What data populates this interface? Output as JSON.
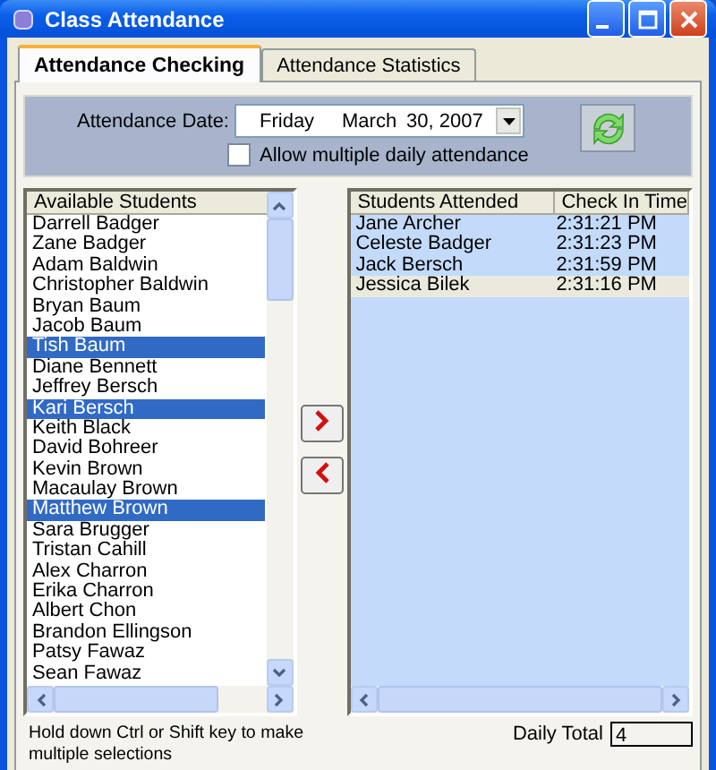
{
  "window": {
    "title": "Class Attendance"
  },
  "tabs": [
    {
      "label": "Attendance Checking",
      "selected": true
    },
    {
      "label": "Attendance Statistics",
      "selected": false
    }
  ],
  "date_field": {
    "label": "Attendance Date:",
    "weekday": "Friday",
    "month": "March",
    "day_year": "30, 2007"
  },
  "multiple_attendance": {
    "label": "Allow multiple daily attendance",
    "checked": false
  },
  "available_students": {
    "header": "Available Students",
    "items": [
      {
        "name": "Darrell Badger",
        "selected": false
      },
      {
        "name": "Zane Badger",
        "selected": false
      },
      {
        "name": "Adam Baldwin",
        "selected": false
      },
      {
        "name": "Christopher Baldwin",
        "selected": false
      },
      {
        "name": "Bryan Baum",
        "selected": false
      },
      {
        "name": "Jacob Baum",
        "selected": false
      },
      {
        "name": "Tish Baum",
        "selected": true
      },
      {
        "name": "Diane Bennett",
        "selected": false
      },
      {
        "name": "Jeffrey Bersch",
        "selected": false
      },
      {
        "name": "Kari Bersch",
        "selected": true
      },
      {
        "name": "Keith Black",
        "selected": false
      },
      {
        "name": "David Bohreer",
        "selected": false
      },
      {
        "name": "Kevin Brown",
        "selected": false
      },
      {
        "name": "Macaulay Brown",
        "selected": false
      },
      {
        "name": "Matthew Brown",
        "selected": true
      },
      {
        "name": "Sara Brugger",
        "selected": false
      },
      {
        "name": "Tristan Cahill",
        "selected": false
      },
      {
        "name": "Alex Charron",
        "selected": false
      },
      {
        "name": "Erika Charron",
        "selected": false
      },
      {
        "name": "Albert Chon",
        "selected": false
      },
      {
        "name": "Brandon Ellingson",
        "selected": false
      },
      {
        "name": "Patsy Fawaz",
        "selected": false
      },
      {
        "name": "Sean Fawaz",
        "selected": false
      }
    ]
  },
  "attended": {
    "columns": [
      "Students Attended",
      "Check In Time"
    ],
    "rows": [
      {
        "name": "Jane Archer",
        "time": "2:31:21 PM",
        "selected": false
      },
      {
        "name": "Celeste Badger",
        "time": "2:31:23 PM",
        "selected": false
      },
      {
        "name": "Jack Bersch",
        "time": "2:31:59 PM",
        "selected": false
      },
      {
        "name": "Jessica Bilek",
        "time": "2:31:16 PM",
        "selected": true
      }
    ]
  },
  "hint": "Hold down Ctrl or Shift key to make multiple selections",
  "daily_total": {
    "label": "Daily Total",
    "value": "4"
  }
}
